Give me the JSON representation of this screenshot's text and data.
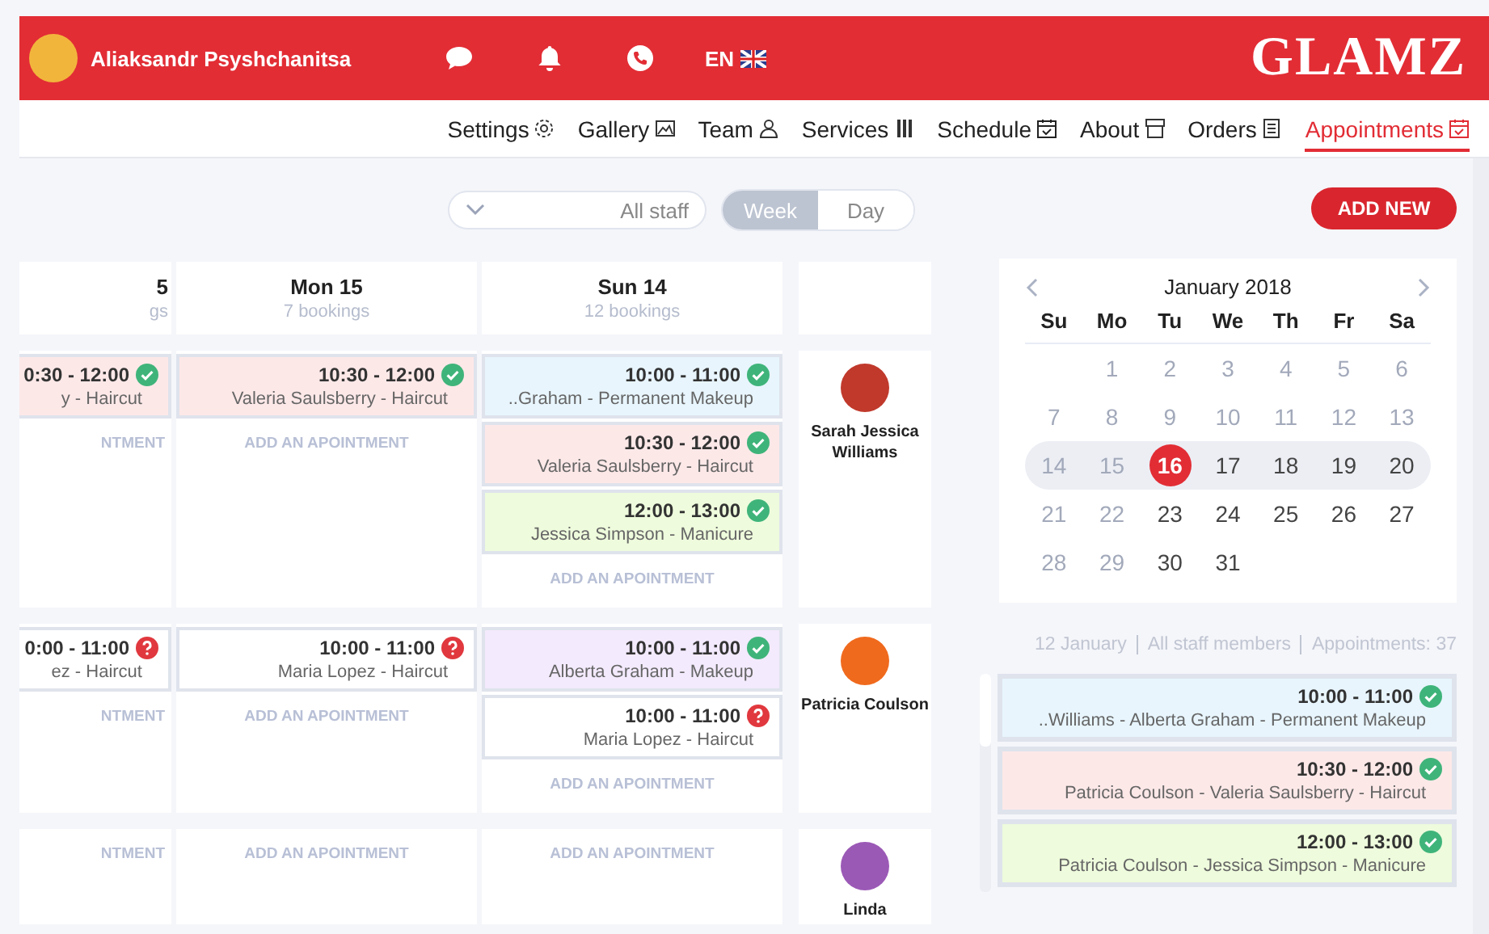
{
  "header": {
    "user_name": "Aliaksandr Psyshchanitsa",
    "language": "EN",
    "logo": "GLAMZ"
  },
  "nav": [
    {
      "label": "Settings",
      "selected": false
    },
    {
      "label": "Gallery",
      "selected": false
    },
    {
      "label": "Team",
      "selected": false
    },
    {
      "label": "Services",
      "selected": false
    },
    {
      "label": "Schedule",
      "selected": false
    },
    {
      "label": "About",
      "selected": false
    },
    {
      "label": "Orders",
      "selected": false
    },
    {
      "label": "Appointments",
      "selected": true
    }
  ],
  "staff_filter": {
    "value": "All staff"
  },
  "view_options": [
    {
      "label": "Week",
      "selected": true
    },
    {
      "label": "Day",
      "selected": false
    }
  ],
  "add_button": "ADD NEW",
  "day_headers": [
    {
      "day": "5",
      "bookings": "gs"
    },
    {
      "day": "Mon 15",
      "bookings": "7 bookings"
    },
    {
      "day": "Sun 14",
      "bookings": "12 bookings"
    }
  ],
  "rows": [
    {
      "staff": "Sarah Jessica Williams",
      "days": [
        {
          "appointments": [
            {
              "time": "0:30 - 12:00",
              "client": "y - Haircut",
              "confirmed": true,
              "color": "#fde8e8"
            }
          ],
          "add_label": "NTMENT"
        },
        {
          "appointments": [
            {
              "time": "10:30 - 12:00",
              "client": "Valeria Saulsberry - Haircut",
              "confirmed": true,
              "color": "#fde8e8"
            }
          ],
          "add_label": "ADD AN APOINTMENT"
        },
        {
          "appointments": [
            {
              "time": "10:00 - 11:00",
              "client": "..Graham - Permanent Makeup",
              "confirmed": true,
              "color": "#e8f5fd"
            },
            {
              "time": "10:30 - 12:00",
              "client": "Valeria Saulsberry - Haircut",
              "confirmed": true,
              "color": "#fde8e8"
            },
            {
              "time": "12:00 - 13:00",
              "client": "Jessica Simpson - Manicure",
              "confirmed": true,
              "color": "#eefbdc"
            }
          ],
          "add_label": "ADD AN APOINTMENT"
        }
      ]
    },
    {
      "staff": "Patricia Coulson",
      "days": [
        {
          "appointments": [
            {
              "time": "0:00 - 11:00",
              "client": "ez - Haircut",
              "confirmed": false,
              "color": "#ffffff"
            }
          ],
          "add_label": "NTMENT"
        },
        {
          "appointments": [
            {
              "time": "10:00 - 11:00",
              "client": "Maria Lopez - Haircut",
              "confirmed": false,
              "color": "#ffffff"
            }
          ],
          "add_label": "ADD AN APOINTMENT"
        },
        {
          "appointments": [
            {
              "time": "10:00 - 11:00",
              "client": "Alberta Graham - Makeup",
              "confirmed": true,
              "color": "#f3eafd"
            },
            {
              "time": "10:00 - 11:00",
              "client": "Maria Lopez - Haircut",
              "confirmed": false,
              "color": "#ffffff"
            }
          ],
          "add_label": "ADD AN APOINTMENT"
        }
      ]
    },
    {
      "staff": "Linda",
      "days": [
        {
          "add_label": "NTMENT"
        },
        {
          "add_label": "ADD AN APOINTMENT"
        },
        {
          "add_label": "ADD AN APOINTMENT"
        }
      ]
    }
  ],
  "calendar": {
    "month": "January 2018",
    "weekdays": [
      "Su",
      "Mo",
      "Tu",
      "We",
      "Th",
      "Fr",
      "Sa"
    ],
    "weeks": [
      {
        "selected": false,
        "days": [
          {
            "label": "1",
            "muted": true,
            "selected": false
          },
          {
            "label": "2",
            "muted": true,
            "selected": false
          },
          {
            "label": "3",
            "muted": true,
            "selected": false
          },
          {
            "label": "4",
            "muted": true,
            "selected": false
          },
          {
            "label": "5",
            "muted": true,
            "selected": false
          },
          {
            "label": "6",
            "muted": true,
            "selected": false
          }
        ]
      },
      {
        "selected": false,
        "days": [
          {
            "label": "7",
            "muted": true,
            "selected": false
          },
          {
            "label": "8",
            "muted": true,
            "selected": false
          },
          {
            "label": "9",
            "muted": true,
            "selected": false
          },
          {
            "label": "10",
            "muted": true,
            "selected": false
          },
          {
            "label": "11",
            "muted": true,
            "selected": false
          },
          {
            "label": "12",
            "muted": true,
            "selected": false
          },
          {
            "label": "13",
            "muted": true,
            "selected": false
          }
        ]
      },
      {
        "selected": true,
        "days": [
          {
            "label": "14",
            "muted": true,
            "selected": false
          },
          {
            "label": "15",
            "muted": true,
            "selected": false
          },
          {
            "label": "16",
            "muted": false,
            "selected": true
          },
          {
            "label": "17",
            "muted": false,
            "selected": false
          },
          {
            "label": "18",
            "muted": false,
            "selected": false
          },
          {
            "label": "19",
            "muted": false,
            "selected": false
          },
          {
            "label": "20",
            "muted": false,
            "selected": false
          }
        ]
      },
      {
        "selected": false,
        "days": [
          {
            "label": "21",
            "muted": true,
            "selected": false
          },
          {
            "label": "22",
            "muted": true,
            "selected": false
          },
          {
            "label": "23",
            "muted": false,
            "selected": false
          },
          {
            "label": "24",
            "muted": false,
            "selected": false
          },
          {
            "label": "25",
            "muted": false,
            "selected": false
          },
          {
            "label": "26",
            "muted": false,
            "selected": false
          },
          {
            "label": "27",
            "muted": false,
            "selected": false
          }
        ]
      },
      {
        "selected": false,
        "days": [
          {
            "label": "28",
            "muted": true,
            "selected": false
          },
          {
            "label": "29",
            "muted": true,
            "selected": false
          },
          {
            "label": "30",
            "muted": false,
            "selected": false
          },
          {
            "label": "31",
            "muted": false,
            "selected": false
          }
        ]
      }
    ]
  },
  "summary": [
    "12 January",
    "All staff members",
    "Appointments: 37"
  ],
  "day_list": [
    {
      "time": "10:00 - 11:00",
      "client": "..Williams - Alberta Graham - Permanent Makeup",
      "confirmed": true,
      "color": "#e8f5fd"
    },
    {
      "time": "10:30 - 12:00",
      "client": "Patricia Coulson - Valeria Saulsberry - Haircut",
      "confirmed": true,
      "color": "#fde8e8"
    },
    {
      "time": "12:00 - 13:00",
      "client": "Patricia Coulson - Jessica Simpson - Manicure",
      "confirmed": true,
      "color": "#eefbdc"
    }
  ]
}
